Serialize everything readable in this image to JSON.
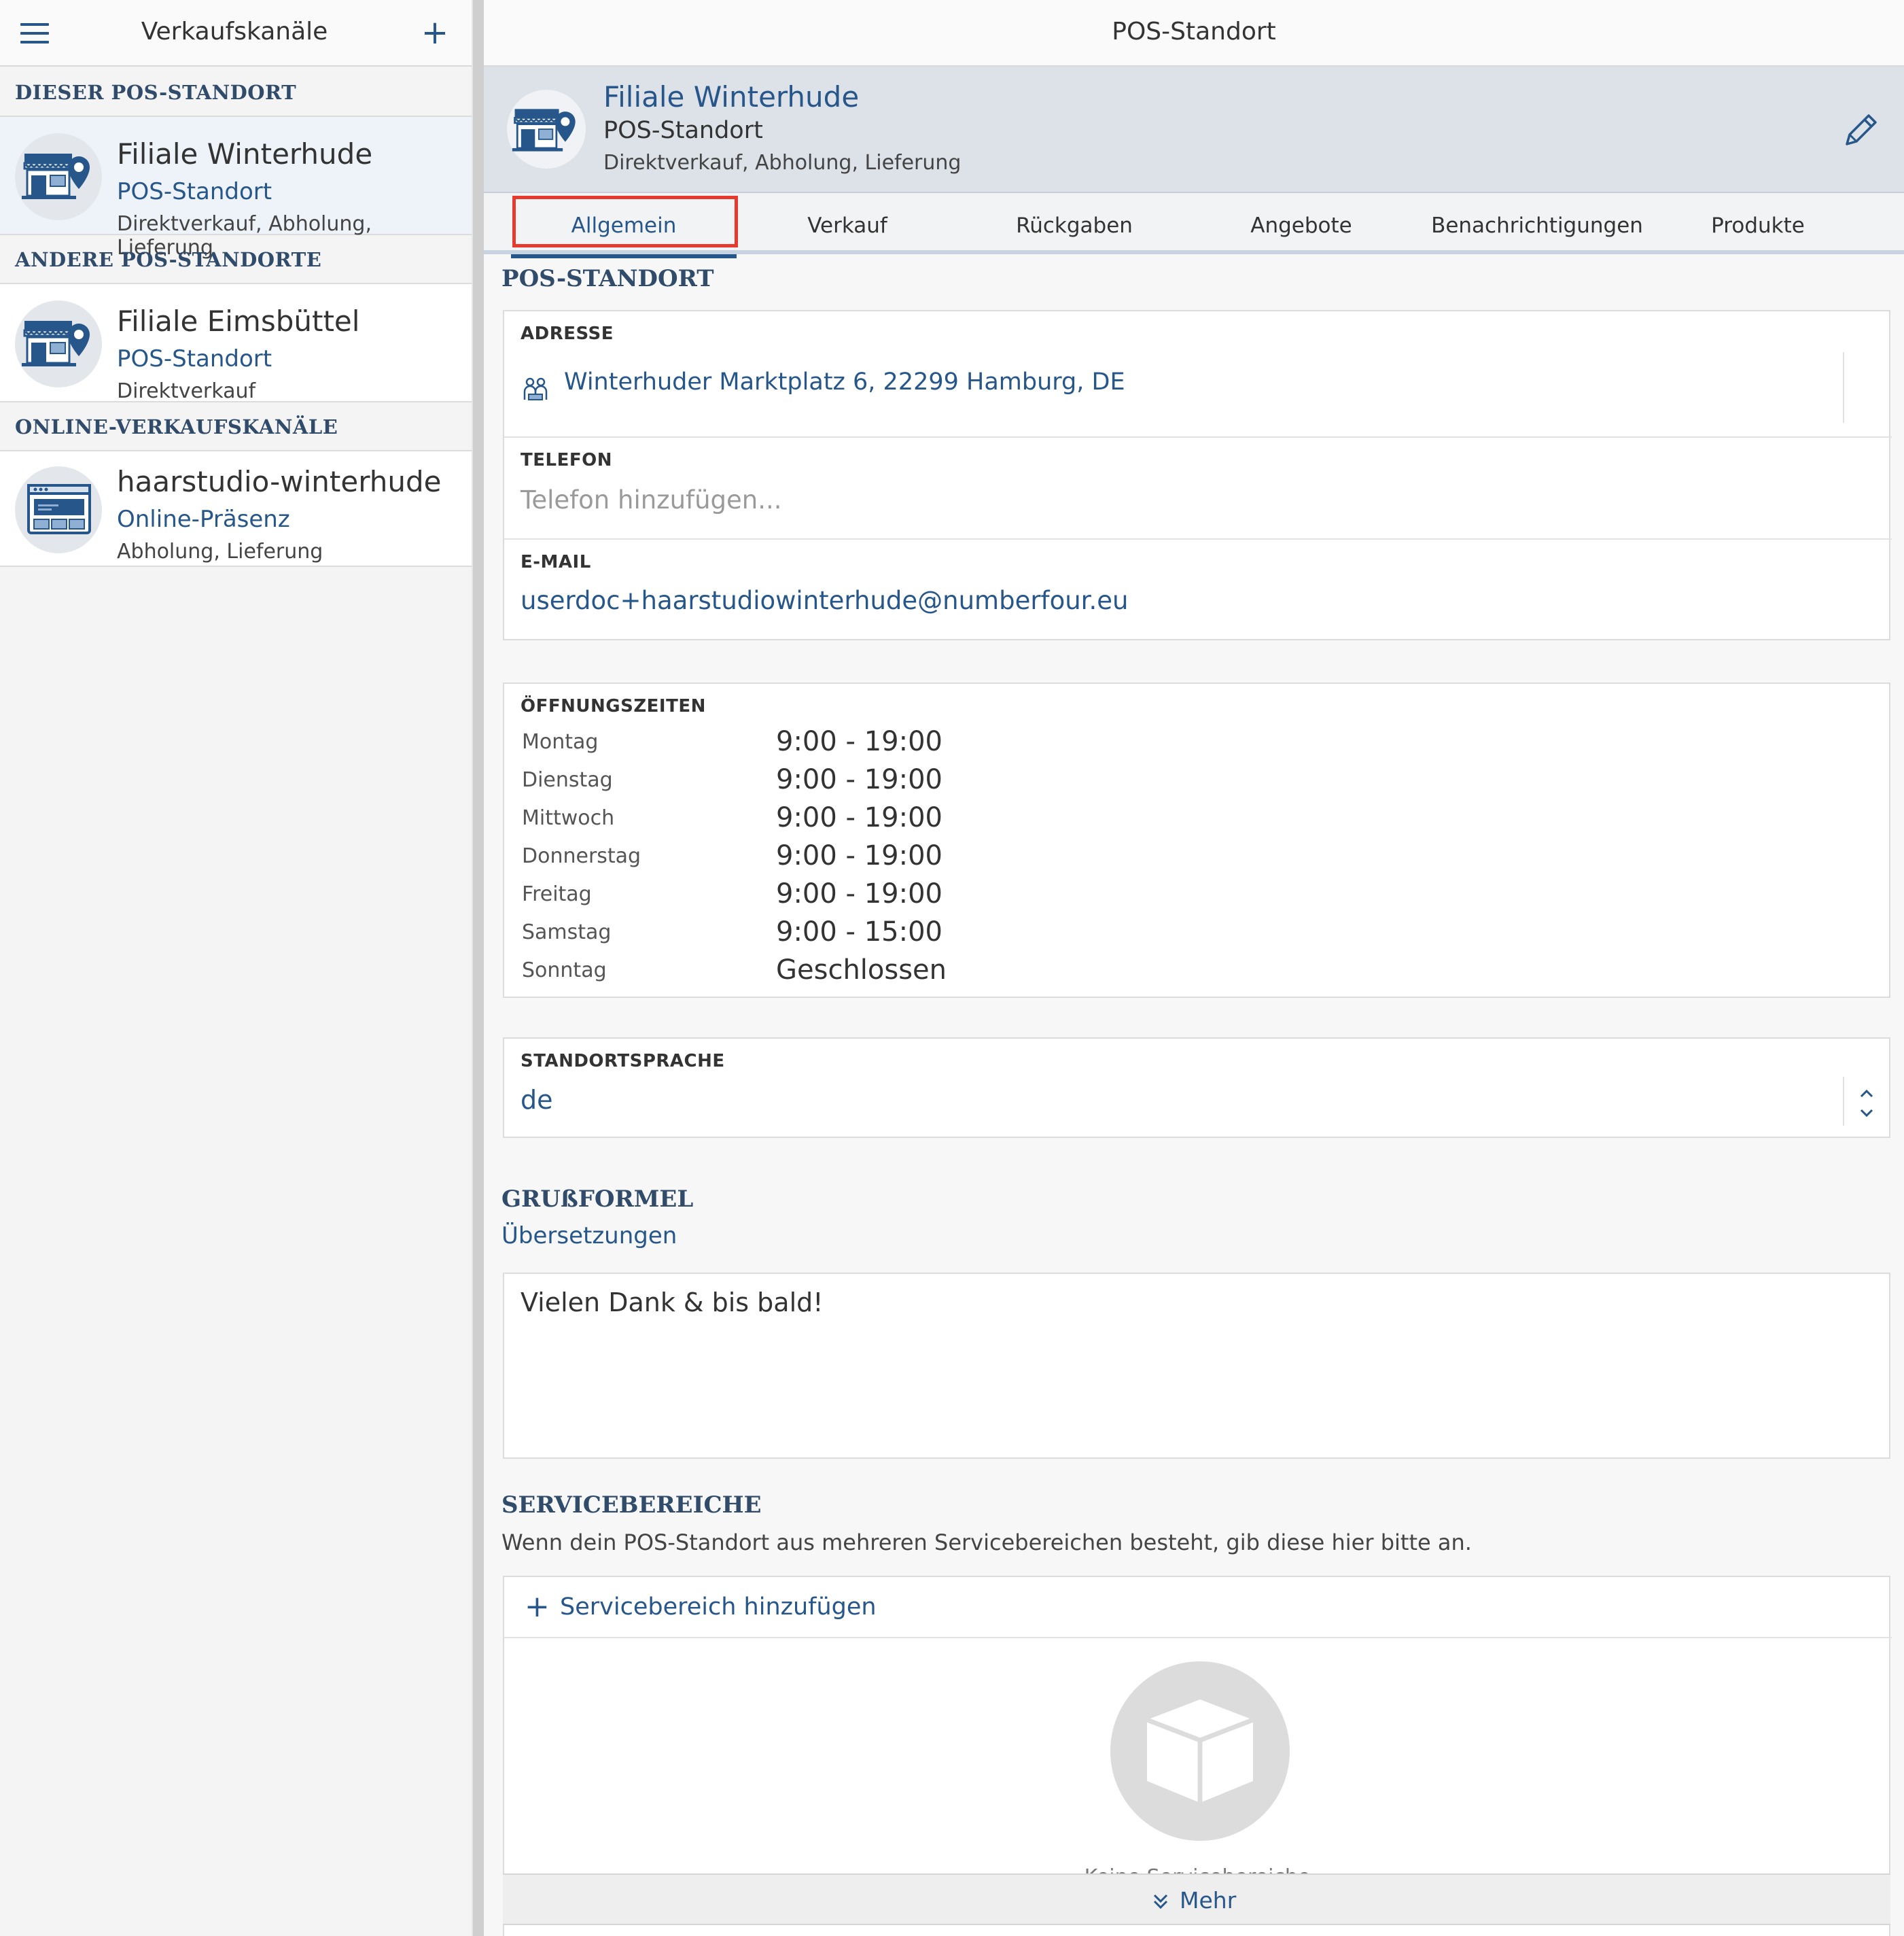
{
  "sidebar": {
    "title": "Verkaufskanäle",
    "add_label": "+",
    "sections": [
      {
        "heading": "DIESER POS-STANDORT",
        "items": [
          {
            "name": "Filiale Winterhude",
            "type": "POS-Standort",
            "sub": "Direktverkauf, Abholung, Lieferung",
            "icon": "store-location-icon"
          }
        ]
      },
      {
        "heading": "ANDERE POS-STANDORTE",
        "items": [
          {
            "name": "Filiale Eimsbüttel",
            "type": "POS-Standort",
            "sub": "Direktverkauf",
            "icon": "store-location-icon"
          }
        ]
      },
      {
        "heading": "ONLINE-VERKAUFSKANÄLE",
        "items": [
          {
            "name": "haarstudio-winterhude",
            "type": "Online-Präsenz",
            "sub": "Abholung, Lieferung",
            "icon": "browser-window-icon"
          }
        ]
      }
    ]
  },
  "header": {
    "title": "POS-Standort"
  },
  "store": {
    "name": "Filiale Winterhude",
    "type": "POS-Standort",
    "sub": "Direktverkauf, Abholung, Lieferung"
  },
  "tabs": [
    {
      "label": "Allgemein",
      "active": true
    },
    {
      "label": "Verkauf"
    },
    {
      "label": "Rückgaben"
    },
    {
      "label": "Angebote"
    },
    {
      "label": "Benachrichtigungen"
    },
    {
      "label": "Produkte"
    }
  ],
  "pos_section": {
    "title": "POS-STANDORT",
    "address_label": "ADRESSE",
    "address_value": "Winterhuder Marktplatz 6, 22299 Hamburg, DE",
    "phone_label": "TELEFON",
    "phone_placeholder": "Telefon hinzufügen...",
    "email_label": "E-MAIL",
    "email_value": "userdoc+haarstudiowinterhude@numberfour.eu"
  },
  "opening_hours": {
    "label": "ÖFFNUNGSZEITEN",
    "days": [
      {
        "day": "Montag",
        "time": "9:00 - 19:00"
      },
      {
        "day": "Dienstag",
        "time": "9:00 - 19:00"
      },
      {
        "day": "Mittwoch",
        "time": "9:00 - 19:00"
      },
      {
        "day": "Donnerstag",
        "time": "9:00 - 19:00"
      },
      {
        "day": "Freitag",
        "time": "9:00 - 19:00"
      },
      {
        "day": "Samstag",
        "time": "9:00 - 15:00"
      },
      {
        "day": "Sonntag",
        "time": "Geschlossen"
      }
    ]
  },
  "language": {
    "label": "STANDORTSPRACHE",
    "value": "de"
  },
  "greeting": {
    "title": "GRUßFORMEL",
    "translations_link": "Übersetzungen",
    "text": "Vielen Dank & bis bald!"
  },
  "service_areas": {
    "title": "SERVICEBEREICHE",
    "description": "Wenn dein POS-Standort aus mehreren Servicebereichen besteht, gib diese hier bitte an.",
    "add_label": "Servicebereich hinzufügen",
    "empty_label": "Keine Servicebereiche",
    "more_label": "Mehr"
  },
  "colors": {
    "accent": "#27578a",
    "section_heading": "#314c6b",
    "highlight_box": "#e63a2e"
  }
}
